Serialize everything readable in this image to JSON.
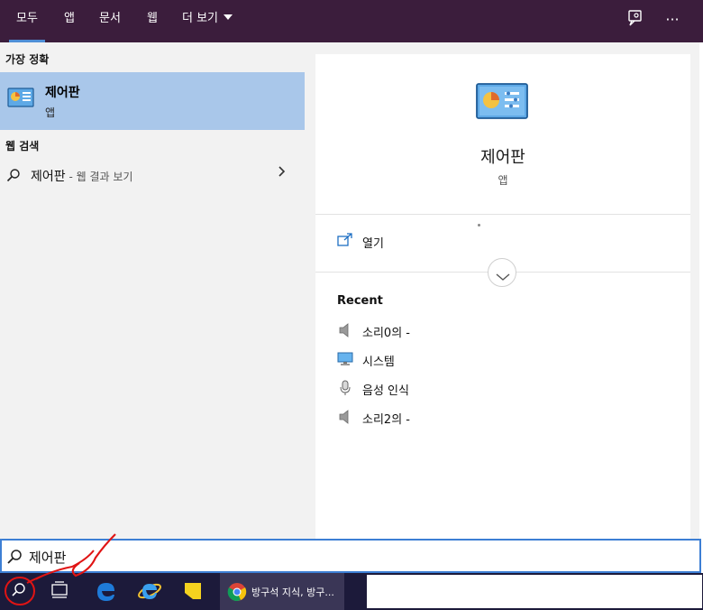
{
  "tabs": [
    {
      "label": "모두",
      "active": true
    },
    {
      "label": "앱"
    },
    {
      "label": "문서"
    },
    {
      "label": "웹"
    },
    {
      "label": "더 보기"
    }
  ],
  "top_icons": [
    "feedback-icon",
    "more-icon"
  ],
  "more_glyph": "···",
  "left": {
    "best_match_header": "가장 정확",
    "best_match": {
      "name": "제어판",
      "type": "앱"
    },
    "web_header": "웹 검색",
    "web_result": {
      "query": "제어판",
      "hint": " - 웹 결과 보기"
    }
  },
  "preview": {
    "title": "제어판",
    "type": "앱",
    "open_label": "열기",
    "recent_header": "Recent",
    "recent": [
      {
        "label": "소리0의 -",
        "icon": "speaker-icon"
      },
      {
        "label": "시스템",
        "icon": "monitor-icon"
      },
      {
        "label": "음성 인식",
        "icon": "microphone-icon"
      },
      {
        "label": "소리2의 -",
        "icon": "speaker-icon"
      }
    ]
  },
  "search": {
    "value": "제어판"
  },
  "taskbar": {
    "chrome_label": "방구석 지식, 방구..."
  },
  "colors": {
    "topbar": "#3b1d3c",
    "selected": "#a9c7ea",
    "accent": "#3d7fd4",
    "taskbar": "#1c1a3a"
  }
}
